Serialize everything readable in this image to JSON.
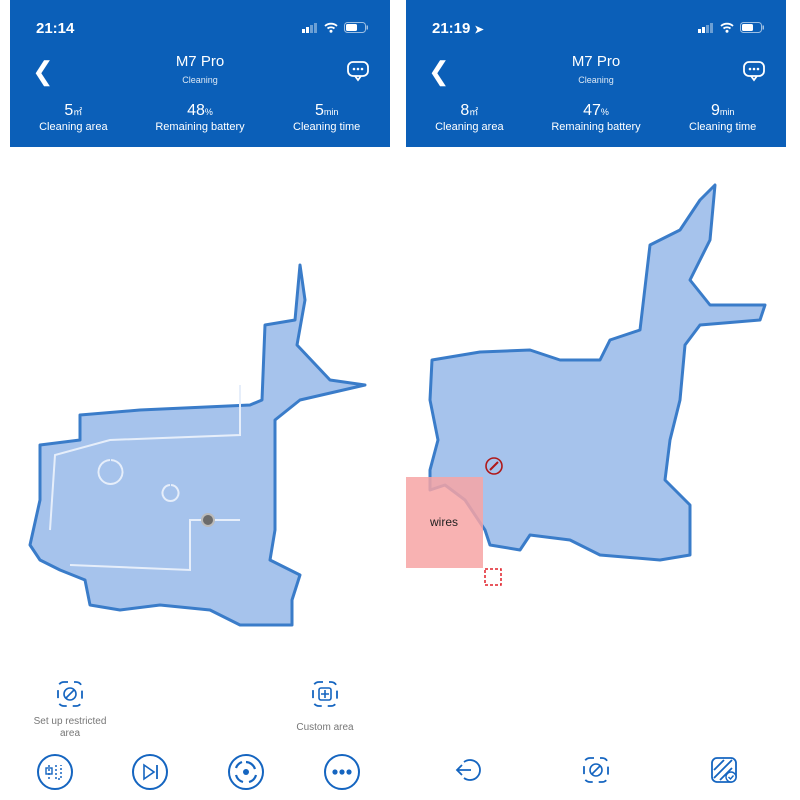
{
  "colors": {
    "header": "#0b5fb8",
    "map_fill": "#a6c3ec",
    "map_border": "#3a7cc9",
    "restricted": "#f7a5a5"
  },
  "screens": [
    {
      "time": "21:14",
      "title": "M7 Pro",
      "status": "Cleaning",
      "stats": [
        {
          "value": "5",
          "unit": "㎡",
          "label": "Cleaning area"
        },
        {
          "value": "48",
          "unit": "%",
          "label": "Remaining battery"
        },
        {
          "value": "5",
          "unit": "min",
          "label": "Cleaning time"
        }
      ],
      "actions": [
        {
          "label": "Set up restricted area",
          "icon": "restricted-area-icon"
        },
        {
          "label": "Custom area",
          "icon": "custom-area-icon"
        }
      ],
      "bottom_icons": [
        "route-icon",
        "skip-icon",
        "suction-icon",
        "more-icon"
      ]
    },
    {
      "time": "21:19",
      "title": "M7 Pro",
      "status": "Cleaning",
      "stats": [
        {
          "value": "8",
          "unit": "㎡",
          "label": "Cleaning area"
        },
        {
          "value": "47",
          "unit": "%",
          "label": "Remaining battery"
        },
        {
          "value": "9",
          "unit": "min",
          "label": "Cleaning time"
        }
      ],
      "zone_label": "wires",
      "bottom_icons": [
        "exit-icon",
        "restricted-area-icon",
        "confirm-zone-icon"
      ]
    }
  ]
}
